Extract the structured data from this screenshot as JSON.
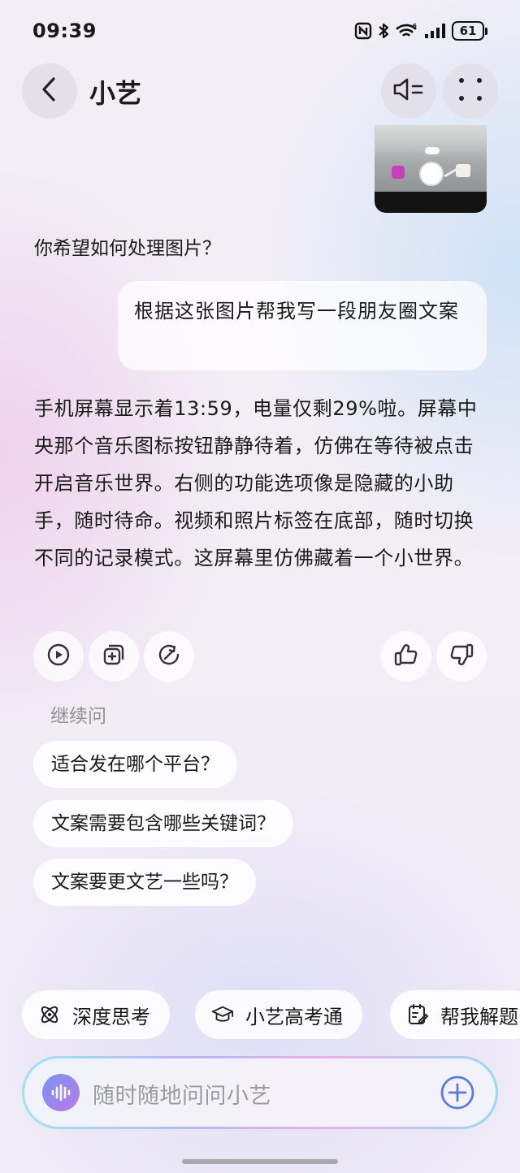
{
  "status_bar": {
    "time": "09:39",
    "battery": "61",
    "icons": [
      "nfc-icon",
      "bluetooth-icon",
      "wifi-icon",
      "signal-icon",
      "battery-icon"
    ]
  },
  "header": {
    "title": "小艺",
    "icons": [
      "back-arrow-icon",
      "speaker-icon",
      "more-dots-icon"
    ]
  },
  "conversation": {
    "assistant_question": "你希望如何处理图片？",
    "user_message": "根据这张图片帮我写一段朋友圈文案",
    "assistant_answer": "手机屏幕显示着13:59，电量仅剩29%啦。屏幕中央那个音乐图标按钮静静待着，仿佛在等待被点击开启音乐世界。右侧的功能选项像是隐藏的小助手，随时待命。视频和照片标签在底部，随时切换不同的记录模式。这屏幕里仿佛藏着一个小世界。",
    "answer_actions": [
      "play-icon",
      "copy-icon",
      "share-icon",
      "thumbs-up-icon",
      "thumbs-down-icon"
    ]
  },
  "followups": {
    "label": "继续问",
    "items": [
      "适合发在哪个平台？",
      "文案需要包含哪些关键词？",
      "文案要更文艺一些吗？"
    ]
  },
  "shortcuts": [
    {
      "label": "深度思考",
      "icon": "atom-icon"
    },
    {
      "label": "小艺高考通",
      "icon": "graduation-cap-icon"
    },
    {
      "label": "帮我解题",
      "icon": "edit-checklist-icon"
    }
  ],
  "input": {
    "placeholder": "随时随地问问小艺"
  },
  "colors": {
    "accent_blue": "#5a7bdb",
    "input_gradient": [
      "#9fe3f0",
      "#b9b7f2",
      "#e9b0e3"
    ]
  }
}
